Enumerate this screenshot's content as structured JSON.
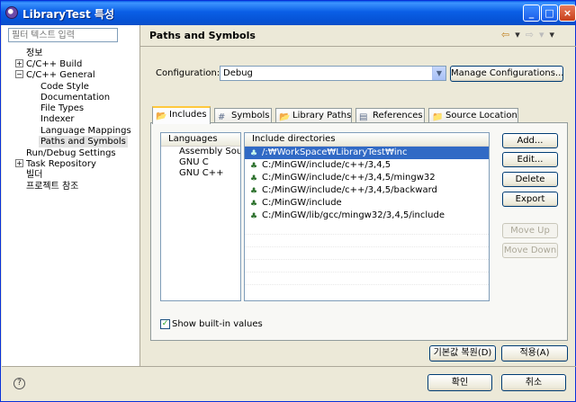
{
  "window": {
    "title": "LibraryTest 특성",
    "controls": [
      "_",
      "□",
      "×"
    ]
  },
  "filter": {
    "placeholder": "필터 텍스트 입력"
  },
  "tree": {
    "items": [
      {
        "label": "정보"
      },
      {
        "label": "C/C++ Build",
        "expander": "+"
      },
      {
        "label": "C/C++ General",
        "expander": "−"
      },
      {
        "label": "Code Style"
      },
      {
        "label": "Documentation"
      },
      {
        "label": "File Types"
      },
      {
        "label": "Indexer"
      },
      {
        "label": "Language Mappings"
      },
      {
        "label": "Paths and Symbols"
      },
      {
        "label": "Run/Debug Settings"
      },
      {
        "label": "Task Repository",
        "expander": "+"
      },
      {
        "label": "빌더"
      },
      {
        "label": "프로젝트 참조"
      }
    ]
  },
  "header": {
    "title": "Paths and Symbols",
    "nav": [
      "⇦",
      "▾",
      "⇨",
      "▾",
      "▾"
    ]
  },
  "configuration": {
    "label": "Configuration:",
    "value": "Debug",
    "manage_label": "Manage Configurations..."
  },
  "tabs": [
    {
      "label": "Includes",
      "icon": "📂"
    },
    {
      "label": "Symbols",
      "icon": "#"
    },
    {
      "label": "Library Paths",
      "icon": "📂"
    },
    {
      "label": "References",
      "icon": "▤"
    },
    {
      "label": "Source Location",
      "icon": "📁"
    }
  ],
  "languages": {
    "header": "Languages",
    "items": [
      "Assembly Sou",
      "GNU C",
      "GNU C++"
    ]
  },
  "directories": {
    "header": "Include directories",
    "items": [
      "/:₩WorkSpace₩LibraryTest₩inc",
      "C:/MinGW/include/c++/3,4,5",
      "C:/MinGW/include/c++/3,4,5/mingw32",
      "C:/MinGW/include/c++/3,4,5/backward",
      "C:/MinGW/include",
      "C:/MinGW/lib/gcc/mingw32/3,4,5/include"
    ]
  },
  "side_buttons": {
    "add": "Add...",
    "edit": "Edit...",
    "delete": "Delete",
    "export": "Export",
    "move_up": "Move Up",
    "move_down": "Move Down"
  },
  "show_builtin": {
    "label": "Show built-in values",
    "checked": "✓"
  },
  "footer": {
    "restore_defaults": "기본값 복원(D)",
    "apply": "적용(A)",
    "ok": "확인",
    "cancel": "취소",
    "help": "?"
  }
}
